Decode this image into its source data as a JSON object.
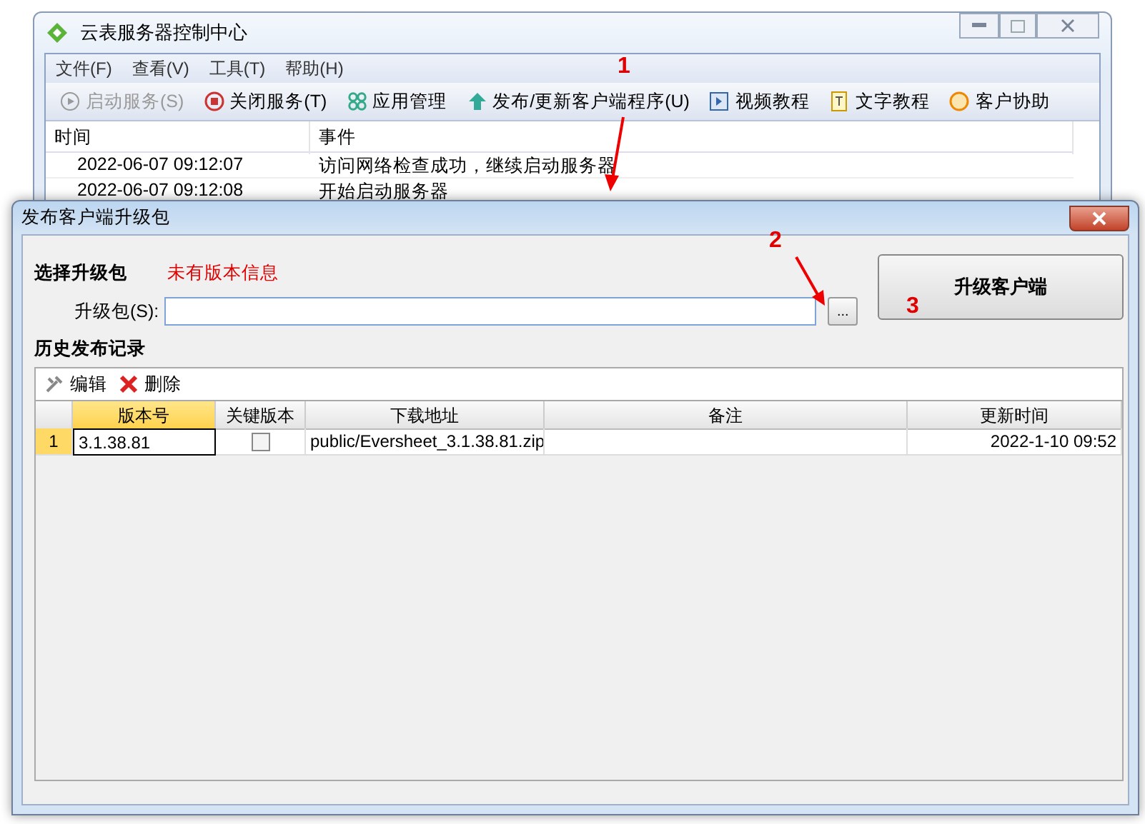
{
  "main_window": {
    "title": "云表服务器控制中心",
    "menu": [
      "文件(F)",
      "查看(V)",
      "工具(T)",
      "帮助(H)"
    ],
    "toolbar": [
      {
        "kind": "play",
        "label": "启动服务(S)",
        "disabled": true
      },
      {
        "kind": "stop",
        "label": "关闭服务(T)",
        "disabled": false
      },
      {
        "kind": "apps",
        "label": "应用管理",
        "disabled": false
      },
      {
        "kind": "upload",
        "label": "发布/更新客户端程序(U)",
        "disabled": false
      },
      {
        "kind": "video",
        "label": "视频教程",
        "disabled": false
      },
      {
        "kind": "doc",
        "label": "文字教程",
        "disabled": false
      },
      {
        "kind": "chat",
        "label": "客户协助",
        "disabled": false
      }
    ],
    "log": {
      "columns": [
        "时间",
        "事件"
      ],
      "rows": [
        [
          "2022-06-07 09:12:07",
          "访问网络检查成功，继续启动服务器"
        ],
        [
          "2022-06-07 09:12:08",
          "开始启动服务器"
        ]
      ]
    }
  },
  "dialog": {
    "title": "发布客户端升级包",
    "section_title": "选择升级包",
    "version_status": "未有版本信息",
    "package_label": "升级包(S):",
    "browse_button": "...",
    "upgrade_button": "升级客户端",
    "history_title": "历史发布记录",
    "history_toolbar": [
      {
        "kind": "edit",
        "label": "编辑"
      },
      {
        "kind": "delete",
        "label": "删除"
      }
    ],
    "table": {
      "columns": [
        "版本号",
        "关键版本",
        "下载地址",
        "备注",
        "更新时间"
      ],
      "rows": [
        {
          "number": "1",
          "version": "3.1.38.81",
          "key_version": false,
          "url": "public/Eversheet_3.1.38.81.zip",
          "note": "",
          "updated": "2022-1-10 09:52",
          "selected": true
        }
      ]
    }
  },
  "annotations": [
    {
      "label": "1"
    },
    {
      "label": "2"
    },
    {
      "label": "3"
    }
  ]
}
